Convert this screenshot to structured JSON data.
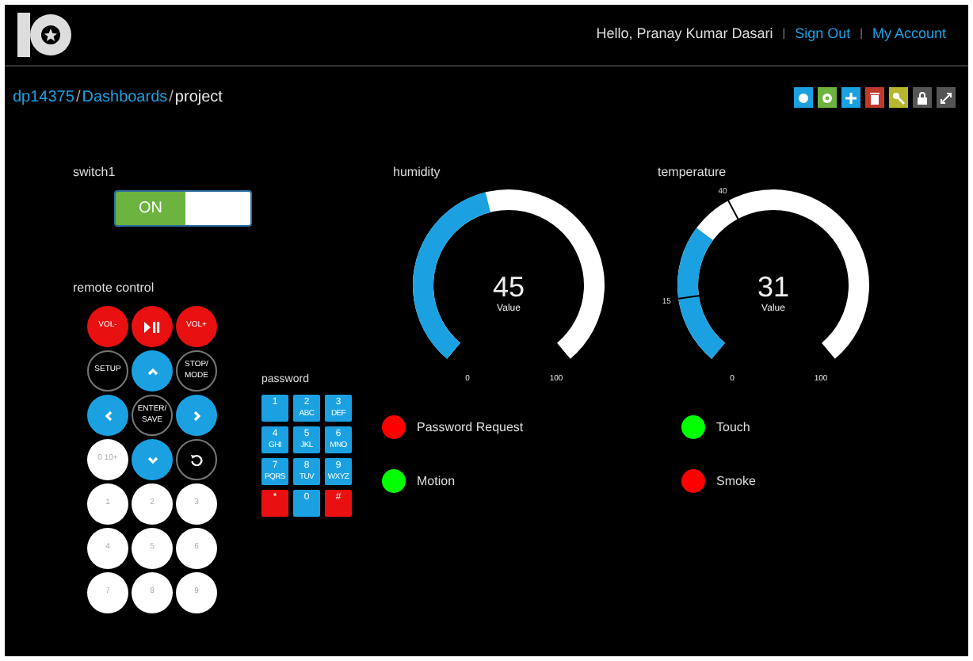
{
  "header": {
    "greeting": "Hello, Pranay Kumar Dasari",
    "separators": [
      "|",
      "|"
    ],
    "links": [
      "Sign Out",
      "My Account"
    ]
  },
  "breadcrumb": {
    "parts": [
      "dp14375",
      "Dashboards"
    ],
    "slashes": [
      "/",
      "/"
    ],
    "current": "project"
  },
  "toolbar": [
    {
      "kind": "help",
      "color": "#1ba1e2"
    },
    {
      "kind": "settings",
      "color": "#6db33f"
    },
    {
      "kind": "add",
      "color": "#1ba1e2"
    },
    {
      "kind": "delete",
      "color": "#c0392b"
    },
    {
      "kind": "key",
      "color": "#b5b530"
    },
    {
      "kind": "lock",
      "color": "#555555"
    },
    {
      "kind": "expand",
      "color": "#555555"
    }
  ],
  "switch": {
    "label": "switch1",
    "text": "ON",
    "on": true
  },
  "remote": {
    "label": "remote control",
    "keys": [
      {
        "kind": "red",
        "label": "VOL-"
      },
      {
        "kind": "play-pause"
      },
      {
        "kind": "red",
        "label": "VOL+"
      },
      {
        "kind": "dark",
        "label": "SETUP"
      },
      {
        "kind": "up"
      },
      {
        "kind": "dark",
        "label": "STOP/ MODE"
      },
      {
        "kind": "left"
      },
      {
        "kind": "dark",
        "label": "ENTER/ SAVE"
      },
      {
        "kind": "right"
      },
      {
        "kind": "white",
        "label": "0 10+"
      },
      {
        "kind": "down"
      },
      {
        "kind": "undo"
      },
      {
        "kind": "white",
        "label": "1"
      },
      {
        "kind": "white",
        "label": "2"
      },
      {
        "kind": "white",
        "label": "3"
      },
      {
        "kind": "white",
        "label": "4"
      },
      {
        "kind": "white",
        "label": "5"
      },
      {
        "kind": "white",
        "label": "6"
      },
      {
        "kind": "white",
        "label": "7"
      },
      {
        "kind": "white",
        "label": "8"
      },
      {
        "kind": "white",
        "label": "9"
      }
    ]
  },
  "password": {
    "label": "password",
    "keys": [
      {
        "kind": "blue",
        "label": "1"
      },
      {
        "kind": "blue",
        "label": "2",
        "letters": "ABC"
      },
      {
        "kind": "blue",
        "label": "3",
        "letters": "DEF"
      },
      {
        "kind": "blue",
        "label": "4",
        "letters": "GHI"
      },
      {
        "kind": "blue",
        "label": "5",
        "letters": "JKL"
      },
      {
        "kind": "blue",
        "label": "6",
        "letters": "MNO"
      },
      {
        "kind": "blue",
        "label": "7",
        "letters": "PQRS"
      },
      {
        "kind": "blue",
        "label": "8",
        "letters": "TUV"
      },
      {
        "kind": "blue",
        "label": "9",
        "letters": "WXYZ"
      },
      {
        "kind": "red",
        "label": "*"
      },
      {
        "kind": "blue",
        "label": "0"
      },
      {
        "kind": "red",
        "label": "#"
      }
    ]
  },
  "gauges": [
    {
      "title": "humidity",
      "value": "45",
      "caption": "Value",
      "min": "0",
      "max": "100"
    },
    {
      "title": "temperature",
      "value": "31",
      "caption": "Value",
      "min": "0",
      "max": "100",
      "markers": [
        {
          "label": "40"
        },
        {
          "label": "15"
        }
      ]
    }
  ],
  "indicators": [
    {
      "label": "Password Request",
      "color": "#ff0000"
    },
    {
      "label": "Touch",
      "color": "#00ff00"
    },
    {
      "label": "Motion",
      "color": "#00ff00"
    },
    {
      "label": "Smoke",
      "color": "#ff0000"
    }
  ]
}
